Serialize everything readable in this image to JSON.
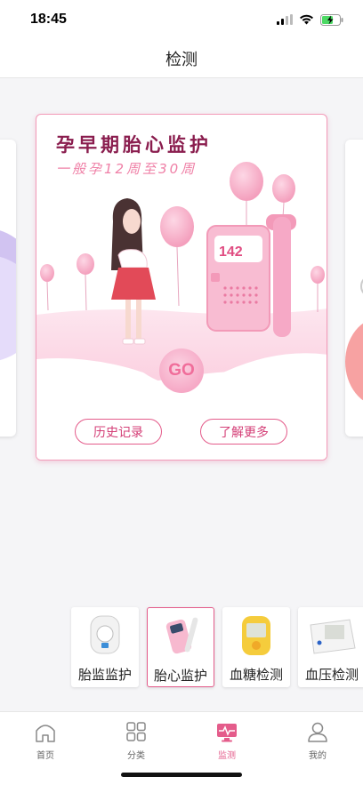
{
  "status_bar": {
    "time": "18:45",
    "icons": [
      "signal-icon",
      "wifi-icon",
      "battery-charging-icon"
    ]
  },
  "nav": {
    "title": "检测"
  },
  "carousel": {
    "main_card": {
      "title": "孕早期胎心监护",
      "subtitle": "一般孕12周至30周",
      "monitor_reading": "142",
      "go_label": "GO",
      "history_label": "历史记录",
      "learn_more_label": "了解更多"
    }
  },
  "products": [
    {
      "label": "胎监监护",
      "icon": "fetal-monitor-device-icon",
      "active": false
    },
    {
      "label": "胎心监护",
      "icon": "doppler-device-icon",
      "active": true
    },
    {
      "label": "血糖检测",
      "icon": "glucose-meter-icon",
      "active": false
    },
    {
      "label": "血压检测",
      "icon": "blood-pressure-meter-icon",
      "active": false
    }
  ],
  "tabs": [
    {
      "label": "首页",
      "icon": "home-icon",
      "active": false
    },
    {
      "label": "分类",
      "icon": "grid-icon",
      "active": false
    },
    {
      "label": "监测",
      "icon": "monitor-icon",
      "active": true
    },
    {
      "label": "我的",
      "icon": "user-icon",
      "active": false
    }
  ],
  "colors": {
    "accent": "#e45c8b",
    "title": "#8a1d4e",
    "subtitle": "#ef7fa6",
    "background": "#f5f5f7"
  }
}
